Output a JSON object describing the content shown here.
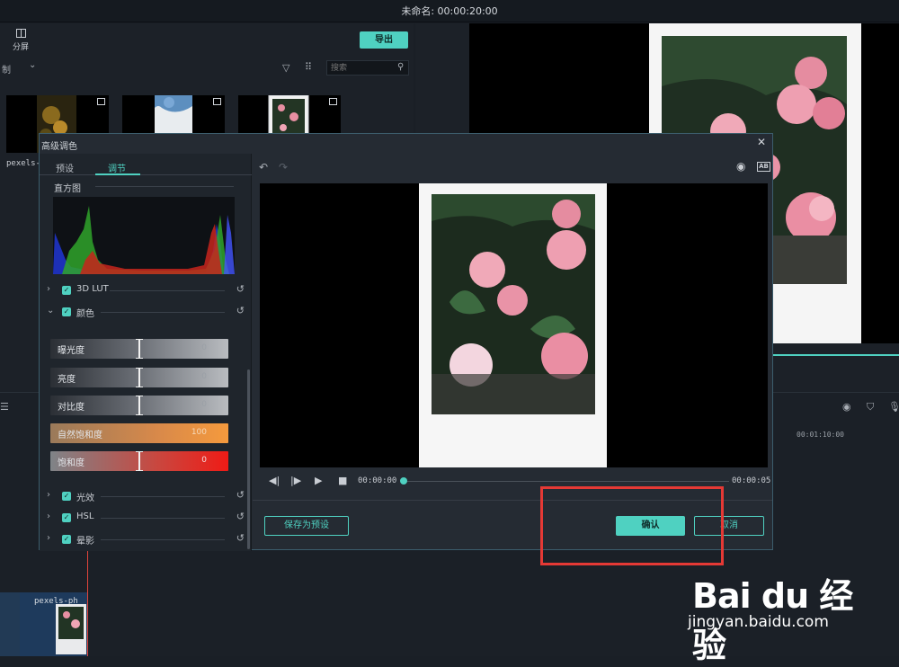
{
  "app": {
    "title": "未命名: 00:00:20:00"
  },
  "media": {
    "split_label": "分屏",
    "export_label": "导出",
    "category_label": "制",
    "search_placeholder": "搜索",
    "thumb_label": "pexels-p"
  },
  "timeline": {
    "time_marker": "00:01:10:00",
    "clip_label": "pexels-ph"
  },
  "dialog": {
    "title": "高级调色",
    "tabs": [
      {
        "label": "预设"
      },
      {
        "label": "调节"
      }
    ],
    "histogram_label": "直方图",
    "sections": [
      {
        "label": "3D LUT",
        "expanded": false,
        "checked": true
      },
      {
        "label": "颜色",
        "expanded": true,
        "checked": true
      },
      {
        "label": "光效",
        "expanded": false,
        "checked": true
      },
      {
        "label": "HSL",
        "expanded": false,
        "checked": true
      },
      {
        "label": "晕影",
        "expanded": false,
        "checked": true
      }
    ],
    "sliders": [
      {
        "label": "曝光度",
        "value": 0
      },
      {
        "label": "亮度",
        "value": 0
      },
      {
        "label": "对比度",
        "value": 0
      },
      {
        "label": "自然饱和度",
        "value": 100
      },
      {
        "label": "饱和度",
        "value": 0
      }
    ],
    "playback": {
      "current": "00:00:00",
      "duration": "00:00:05"
    },
    "save_preset_label": "保存为预设",
    "confirm_label": "确认",
    "cancel_label": "取消"
  },
  "watermark": {
    "brand": "Bai du 经验",
    "url": "jingyan.baidu.com"
  },
  "colors": {
    "accent": "#4fd1c1",
    "highlight": "#e53935"
  }
}
